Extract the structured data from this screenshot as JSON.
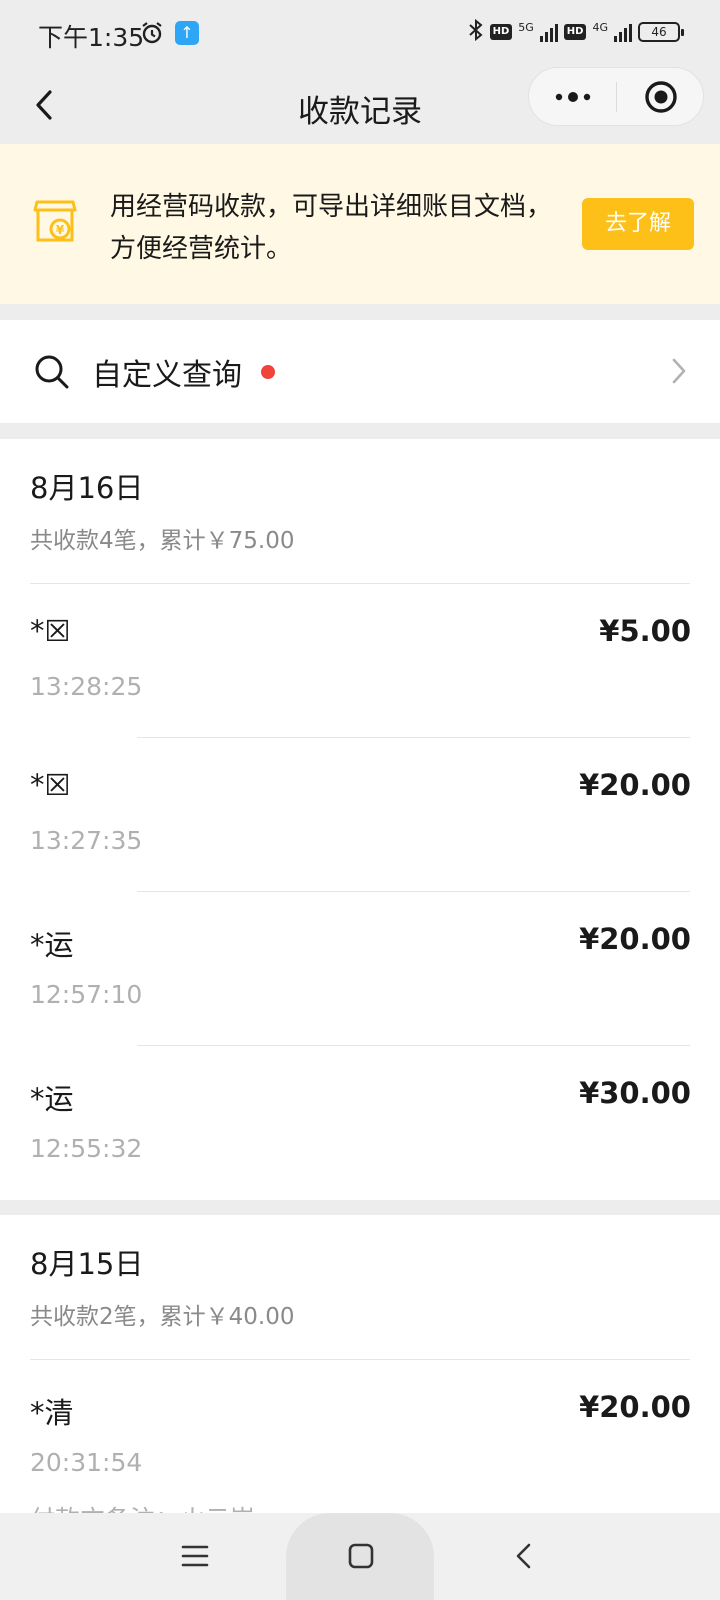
{
  "status_bar": {
    "time": "下午1:35",
    "net1": "5G",
    "net2": "4G",
    "hd": "HD",
    "battery": "46"
  },
  "nav": {
    "title": "收款记录"
  },
  "banner": {
    "text": "用经营码收款，可导出详细账目文档，方便经营统计。",
    "button": "去了解",
    "accent": "#fcc019"
  },
  "query": {
    "label": "自定义查询"
  },
  "groups": [
    {
      "date": "8月16日",
      "summary": "共收款4笔，累计￥75.00",
      "records": [
        {
          "name": "*☒",
          "time": "13:28:25",
          "amount": "¥5.00"
        },
        {
          "name": "*☒",
          "time": "13:27:35",
          "amount": "¥20.00"
        },
        {
          "name": "*运",
          "time": "12:57:10",
          "amount": "¥20.00"
        },
        {
          "name": "*运",
          "time": "12:55:32",
          "amount": "¥30.00"
        }
      ]
    },
    {
      "date": "8月15日",
      "summary": "共收款2笔，累计￥40.00",
      "records": [
        {
          "name": "*清",
          "time": "20:31:54",
          "amount": "¥20.00",
          "note": "付款方备注：火云崽"
        }
      ]
    }
  ]
}
